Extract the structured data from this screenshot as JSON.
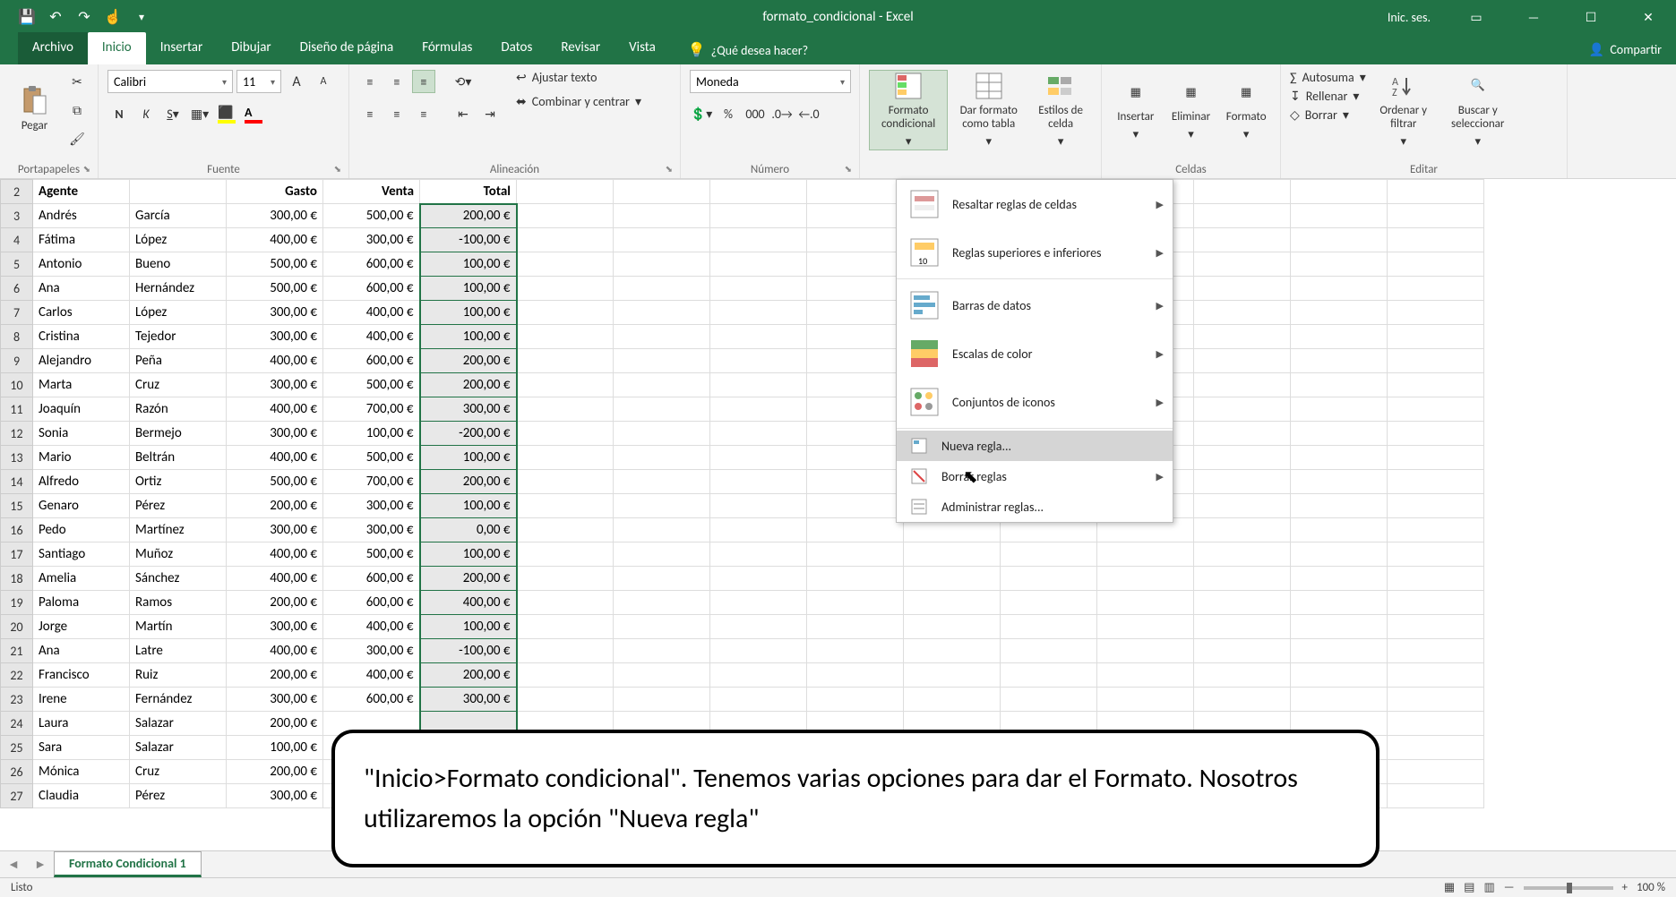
{
  "window": {
    "title": "formato_condicional - Excel",
    "signin": "Inic. ses."
  },
  "tabs": {
    "file": "Archivo",
    "home": "Inicio",
    "insert": "Insertar",
    "draw": "Dibujar",
    "layout": "Diseño de página",
    "formulas": "Fórmulas",
    "data": "Datos",
    "review": "Revisar",
    "view": "Vista",
    "tellme": "¿Qué desea hacer?",
    "share": "Compartir"
  },
  "ribbon": {
    "clipboard": {
      "label": "Portapapeles",
      "paste": "Pegar"
    },
    "font": {
      "label": "Fuente",
      "name": "Calibri",
      "size": "11"
    },
    "align": {
      "label": "Alineación",
      "wrap": "Ajustar texto",
      "merge": "Combinar y centrar"
    },
    "number": {
      "label": "Número",
      "format": "Moneda",
      "symbols": {
        "acc": "000"
      }
    },
    "styles": {
      "cf": "Formato condicional",
      "table": "Dar formato como tabla",
      "cell": "Estilos de celda"
    },
    "cells": {
      "label": "Celdas",
      "insert": "Insertar",
      "delete": "Eliminar",
      "format": "Formato"
    },
    "editing": {
      "label": "Editar",
      "sum": "Autosuma",
      "fill": "Rellenar",
      "clear": "Borrar",
      "sort": "Ordenar y filtrar",
      "find": "Buscar y seleccionar"
    }
  },
  "cf_menu": {
    "highlight": "Resaltar reglas de celdas",
    "toprules": "Reglas superiores e inferiores",
    "databars": "Barras de datos",
    "colorscales": "Escalas de color",
    "iconsets": "Conjuntos de iconos",
    "newrule": "Nueva regla...",
    "clearrules": "Borrar reglas",
    "manage": "Administrar reglas..."
  },
  "headers": {
    "a": "Agente",
    "b": "",
    "c": "Gasto",
    "d": "Venta",
    "e": "Total"
  },
  "rows": [
    {
      "n": 3,
      "fn": "Andrés",
      "ln": "García",
      "g": "300,00 €",
      "v": "500,00 €",
      "t": "200,00 €"
    },
    {
      "n": 4,
      "fn": "Fátima",
      "ln": "López",
      "g": "400,00 €",
      "v": "300,00 €",
      "t": "-100,00 €"
    },
    {
      "n": 5,
      "fn": "Antonio",
      "ln": "Bueno",
      "g": "500,00 €",
      "v": "600,00 €",
      "t": "100,00 €"
    },
    {
      "n": 6,
      "fn": "Ana",
      "ln": "Hernández",
      "g": "500,00 €",
      "v": "600,00 €",
      "t": "100,00 €"
    },
    {
      "n": 7,
      "fn": "Carlos",
      "ln": "López",
      "g": "300,00 €",
      "v": "400,00 €",
      "t": "100,00 €"
    },
    {
      "n": 8,
      "fn": "Cristina",
      "ln": "Tejedor",
      "g": "300,00 €",
      "v": "400,00 €",
      "t": "100,00 €"
    },
    {
      "n": 9,
      "fn": "Alejandro",
      "ln": "Peña",
      "g": "400,00 €",
      "v": "600,00 €",
      "t": "200,00 €"
    },
    {
      "n": 10,
      "fn": "Marta",
      "ln": "Cruz",
      "g": "300,00 €",
      "v": "500,00 €",
      "t": "200,00 €"
    },
    {
      "n": 11,
      "fn": "Joaquín",
      "ln": "Razón",
      "g": "400,00 €",
      "v": "700,00 €",
      "t": "300,00 €"
    },
    {
      "n": 12,
      "fn": "Sonia",
      "ln": "Bermejo",
      "g": "300,00 €",
      "v": "100,00 €",
      "t": "-200,00 €"
    },
    {
      "n": 13,
      "fn": "Mario",
      "ln": "Beltrán",
      "g": "400,00 €",
      "v": "500,00 €",
      "t": "100,00 €"
    },
    {
      "n": 14,
      "fn": "Alfredo",
      "ln": "Ortiz",
      "g": "500,00 €",
      "v": "700,00 €",
      "t": "200,00 €"
    },
    {
      "n": 15,
      "fn": "Genaro",
      "ln": "Pérez",
      "g": "200,00 €",
      "v": "300,00 €",
      "t": "100,00 €"
    },
    {
      "n": 16,
      "fn": "Pedo",
      "ln": "Martínez",
      "g": "300,00 €",
      "v": "300,00 €",
      "t": "0,00 €"
    },
    {
      "n": 17,
      "fn": "Santiago",
      "ln": "Muñoz",
      "g": "400,00 €",
      "v": "500,00 €",
      "t": "100,00 €"
    },
    {
      "n": 18,
      "fn": "Amelia",
      "ln": "Sánchez",
      "g": "400,00 €",
      "v": "600,00 €",
      "t": "200,00 €"
    },
    {
      "n": 19,
      "fn": "Paloma",
      "ln": "Ramos",
      "g": "200,00 €",
      "v": "600,00 €",
      "t": "400,00 €"
    },
    {
      "n": 20,
      "fn": "Jorge",
      "ln": "Martín",
      "g": "300,00 €",
      "v": "400,00 €",
      "t": "100,00 €"
    },
    {
      "n": 21,
      "fn": "Ana",
      "ln": "Latre",
      "g": "400,00 €",
      "v": "300,00 €",
      "t": "-100,00 €"
    },
    {
      "n": 22,
      "fn": "Francisco",
      "ln": "Ruiz",
      "g": "200,00 €",
      "v": "400,00 €",
      "t": "200,00 €"
    },
    {
      "n": 23,
      "fn": "Irene",
      "ln": "Fernández",
      "g": "300,00 €",
      "v": "600,00 €",
      "t": "300,00 €"
    },
    {
      "n": 24,
      "fn": "Laura",
      "ln": "Salazar",
      "g": "200,00 €",
      "v": "",
      "t": ""
    },
    {
      "n": 25,
      "fn": "Sara",
      "ln": "Salazar",
      "g": "100,00 €",
      "v": "",
      "t": ""
    },
    {
      "n": 26,
      "fn": "Mónica",
      "ln": "Cruz",
      "g": "200,00 €",
      "v": "",
      "t": ""
    },
    {
      "n": 27,
      "fn": "Claudia",
      "ln": "Pérez",
      "g": "300,00 €",
      "v": "",
      "t": ""
    }
  ],
  "sheet_tab": "Formato Condicional 1",
  "statusbar": {
    "ready": "Listo",
    "zoom": "100 %"
  },
  "callout": "\"Inicio>Formato condicional\". Tenemos varias opciones para dar el Formato. Nosotros utilizaremos la opción \"Nueva regla\""
}
